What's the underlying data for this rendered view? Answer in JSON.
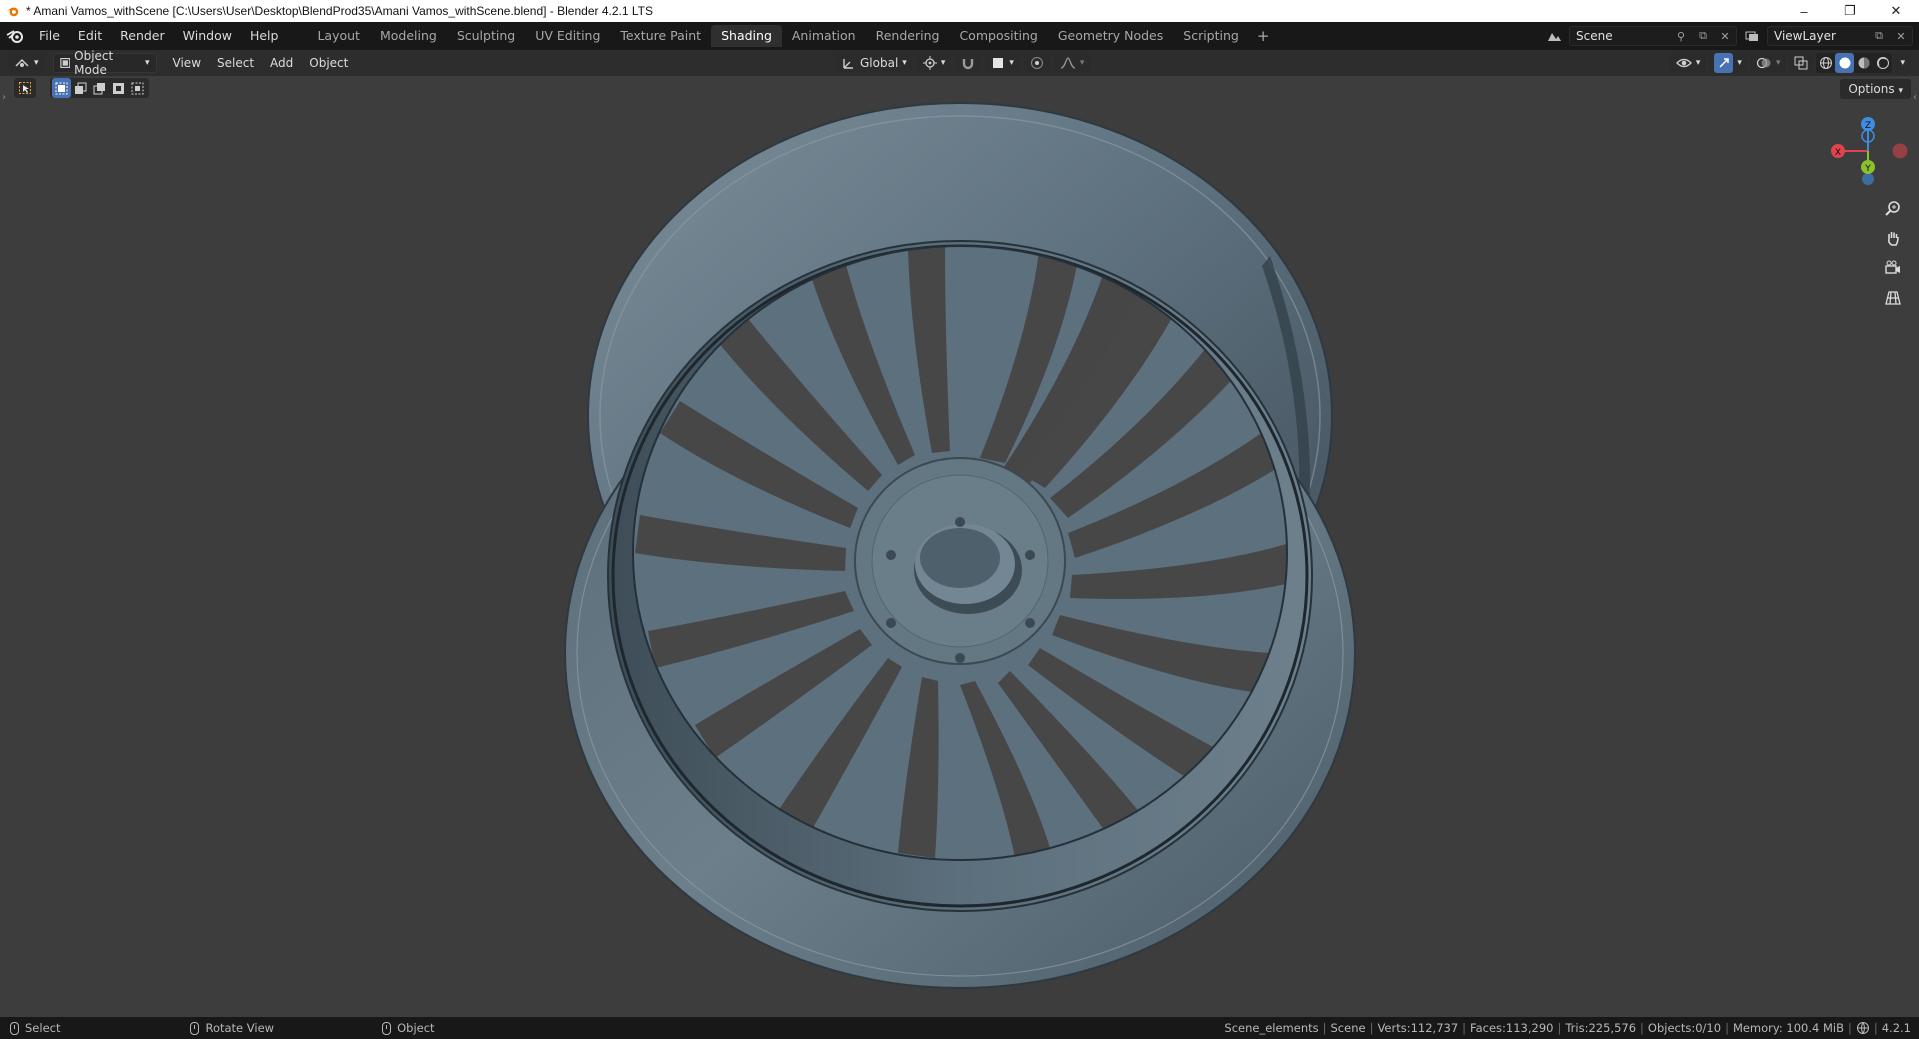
{
  "window": {
    "title": "* Amani Vamos_withScene [C:\\Users\\User\\Desktop\\BlendProd35\\Amani Vamos_withScene.blend] - Blender 4.2.1 LTS",
    "minimize": "–",
    "restore": "❐",
    "close": "✕"
  },
  "menubar": {
    "file": "File",
    "edit": "Edit",
    "render": "Render",
    "window": "Window",
    "help": "Help"
  },
  "workspaces": [
    {
      "label": "Layout",
      "active": false
    },
    {
      "label": "Modeling",
      "active": false
    },
    {
      "label": "Sculpting",
      "active": false
    },
    {
      "label": "UV Editing",
      "active": false
    },
    {
      "label": "Texture Paint",
      "active": false
    },
    {
      "label": "Shading",
      "active": true
    },
    {
      "label": "Animation",
      "active": false
    },
    {
      "label": "Rendering",
      "active": false
    },
    {
      "label": "Compositing",
      "active": false
    },
    {
      "label": "Geometry Nodes",
      "active": false
    },
    {
      "label": "Scripting",
      "active": false
    }
  ],
  "scene": {
    "name": "Scene"
  },
  "view_layer": {
    "name": "ViewLayer"
  },
  "viewport_header": {
    "mode": "Object Mode",
    "view": "View",
    "select": "Select",
    "add": "Add",
    "object": "Object",
    "transform_orientation": "Global",
    "options": "Options"
  },
  "gizmo": {
    "z": "Z",
    "y": "Y",
    "x": "X"
  },
  "statusbar": {
    "select": "Select",
    "rotate_view": "Rotate View",
    "object": "Object",
    "collection": "Scene_elements",
    "scene": "Scene",
    "verts": "Verts:112,737",
    "faces": "Faces:113,290",
    "tris": "Tris:225,576",
    "objects": "Objects:0/10",
    "memory": "Memory: 100.4 MiB",
    "version": "4.2.1"
  },
  "colors": {
    "accent": "#4772b3",
    "axis_x": "#e0434e",
    "axis_y": "#8ac12e",
    "axis_z": "#3d8ee3",
    "wheel": "#5b6e7b"
  }
}
